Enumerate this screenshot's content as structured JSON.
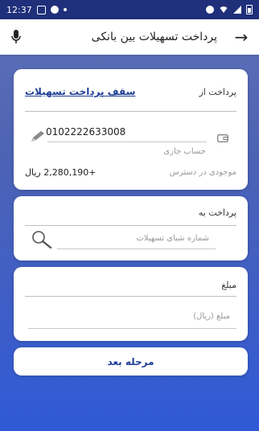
{
  "status_bar": {
    "time": "12:37"
  },
  "header": {
    "title": "پرداخت تسهیلات بین بانکی"
  },
  "source_card": {
    "label": "پرداخت از",
    "limit_link": "سقف پرداخت تسهیلات",
    "account_number": "0102222633008",
    "account_type": "حساب جاری",
    "balance_label": "موجودی در دسترس",
    "balance_value": "+2,280,190 ریال"
  },
  "destination_card": {
    "label": "پرداخت به",
    "loan_placeholder": "شماره شبای تسهیلات"
  },
  "amount_card": {
    "label": "مبلغ",
    "amount_placeholder": "مبلغ (ریال)"
  },
  "actions": {
    "next_label": "مرحله بعد"
  },
  "colors": {
    "status_bar": "#1f2f7a",
    "accent": "#1f3e96",
    "background": "#3f5ec6"
  },
  "icons": [
    "back-arrow-icon",
    "mic-icon",
    "wallet-icon",
    "pencil-icon",
    "search-icon"
  ]
}
